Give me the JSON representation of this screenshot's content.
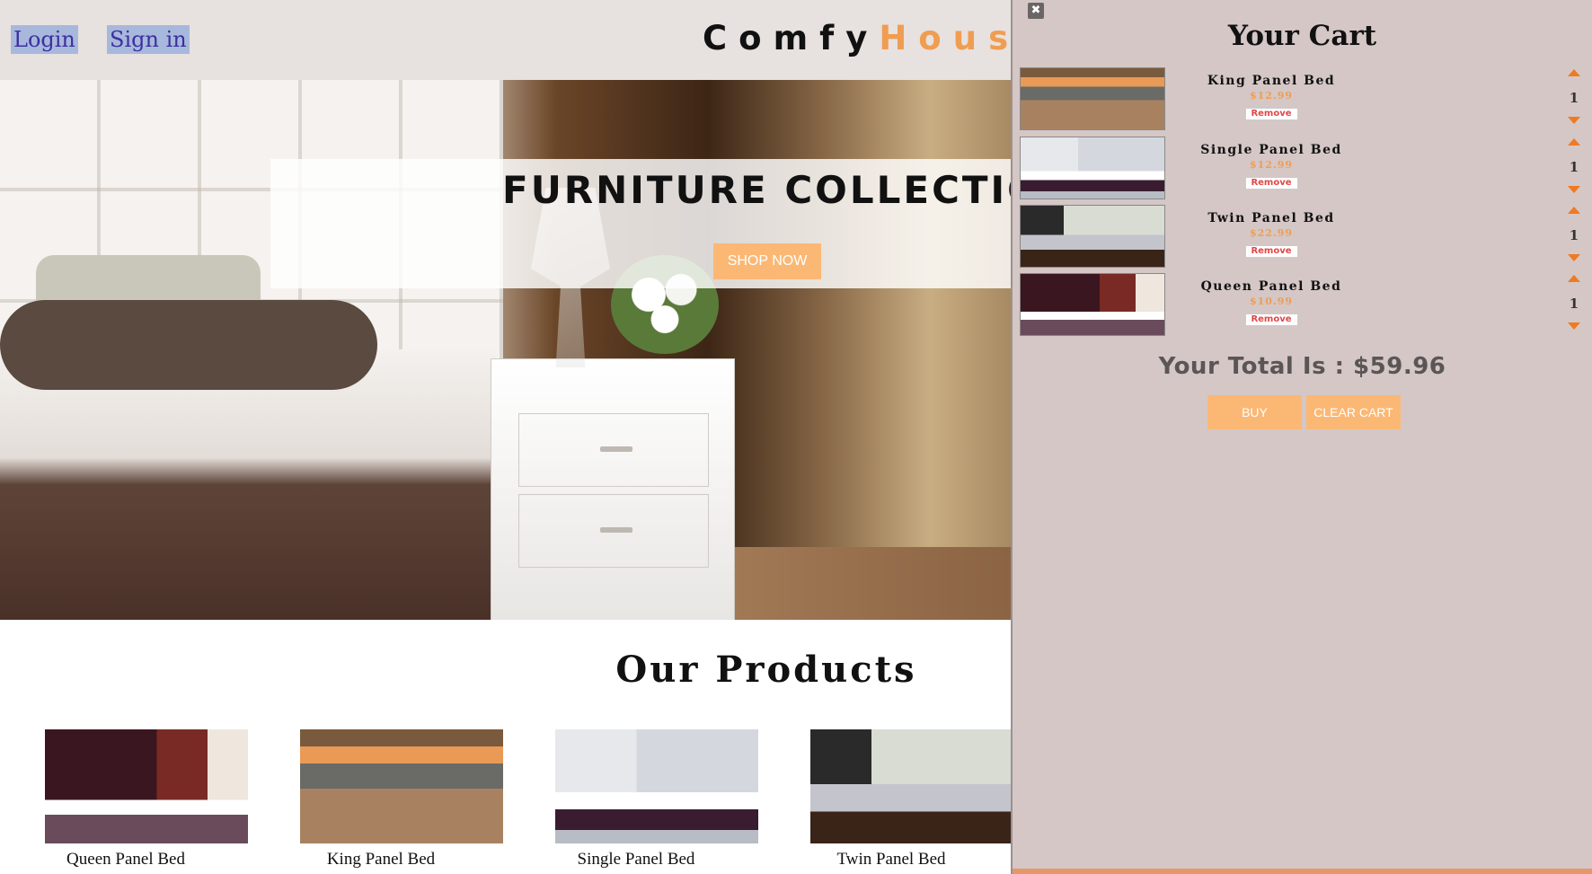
{
  "navbar": {
    "login_label": "Login",
    "signin_label": "Sign in",
    "logo_part1": "Comfy",
    "logo_part2": "House"
  },
  "hero": {
    "title": "FURNITURE COLLECTION",
    "button_label": "SHOP NOW"
  },
  "products": {
    "title": "Our Products",
    "items": [
      {
        "name": "Queen Panel Bed"
      },
      {
        "name": "King Panel Bed"
      },
      {
        "name": "Single Panel Bed"
      },
      {
        "name": "Twin Panel Bed"
      }
    ]
  },
  "cart": {
    "close_label": "✖",
    "title": "Your Cart",
    "items": [
      {
        "name": "King Panel Bed",
        "price": "$12.99",
        "remove_label": "Remove",
        "quantity": "1"
      },
      {
        "name": "Single Panel Bed",
        "price": "$12.99",
        "remove_label": "Remove",
        "quantity": "1"
      },
      {
        "name": "Twin Panel Bed",
        "price": "$22.99",
        "remove_label": "Remove",
        "quantity": "1"
      },
      {
        "name": "Queen Panel Bed",
        "price": "$10.99",
        "remove_label": "Remove",
        "quantity": "1"
      }
    ],
    "total_label": "Your Total Is : $59.96",
    "buy_label": "BUY",
    "clear_label": "CLEAR CART"
  },
  "colors": {
    "accent": "#f09d51",
    "button": "#fbb874",
    "navbar_bg": "#e7e1df",
    "cart_bg": "#d4c7c6",
    "remove_text": "#e04848",
    "arrow": "#f07a22"
  }
}
